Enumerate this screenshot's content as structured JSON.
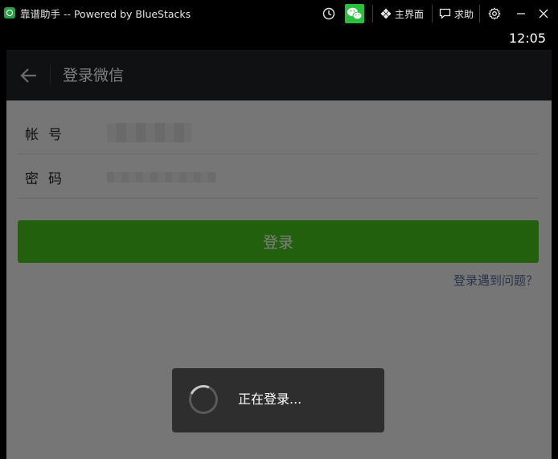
{
  "window": {
    "title": "靠谱助手  -- Powered by BlueStacks",
    "home_label": "主界面",
    "help_label": "求助"
  },
  "statusbar": {
    "time": "12:05"
  },
  "action_bar": {
    "title": "登录微信"
  },
  "form": {
    "account_label": "帐号",
    "password_label": "密码",
    "login_label": "登录",
    "trouble_link": "登录遇到问题？"
  },
  "dialog": {
    "text": "正在登录..."
  },
  "colors": {
    "accent": "#45c01a",
    "link": "#576b95",
    "action_bar": "#1f2225"
  }
}
